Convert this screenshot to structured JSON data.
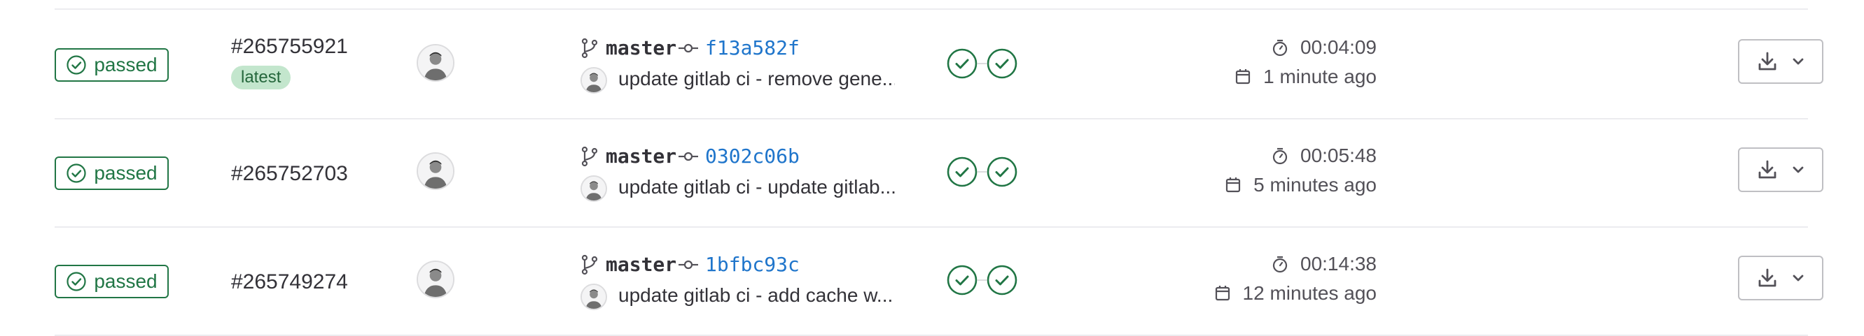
{
  "colors": {
    "success": "#217645",
    "link": "#1f75cb",
    "latest_bg": "#c3e6cd",
    "latest_text": "#24663b",
    "border": "#ececef"
  },
  "pipelines": [
    {
      "status": "passed",
      "id": "#265755921",
      "badge": "latest",
      "branch": "master",
      "sha": "f13a582f",
      "commit_title": "update gitlab ci - remove gene...",
      "stages": [
        "success",
        "success"
      ],
      "duration": "00:04:09",
      "finished": "1 minute ago"
    },
    {
      "status": "passed",
      "id": "#265752703",
      "badge": "",
      "branch": "master",
      "sha": "0302c06b",
      "commit_title": "update gitlab ci - update gitlab...",
      "stages": [
        "success",
        "success"
      ],
      "duration": "00:05:48",
      "finished": "5 minutes ago"
    },
    {
      "status": "passed",
      "id": "#265749274",
      "badge": "",
      "branch": "master",
      "sha": "1bfbc93c",
      "commit_title": "update gitlab ci - add cache w...",
      "stages": [
        "success",
        "success"
      ],
      "duration": "00:14:38",
      "finished": "12 minutes ago"
    }
  ],
  "icons": {
    "status": "status-success-icon",
    "branch": "branch-icon",
    "commit": "commit-icon",
    "stage": "stage-success-icon",
    "duration": "timer-icon",
    "finished": "calendar-icon",
    "artifacts": "download-icon",
    "dropdown": "chevron-down-icon"
  }
}
